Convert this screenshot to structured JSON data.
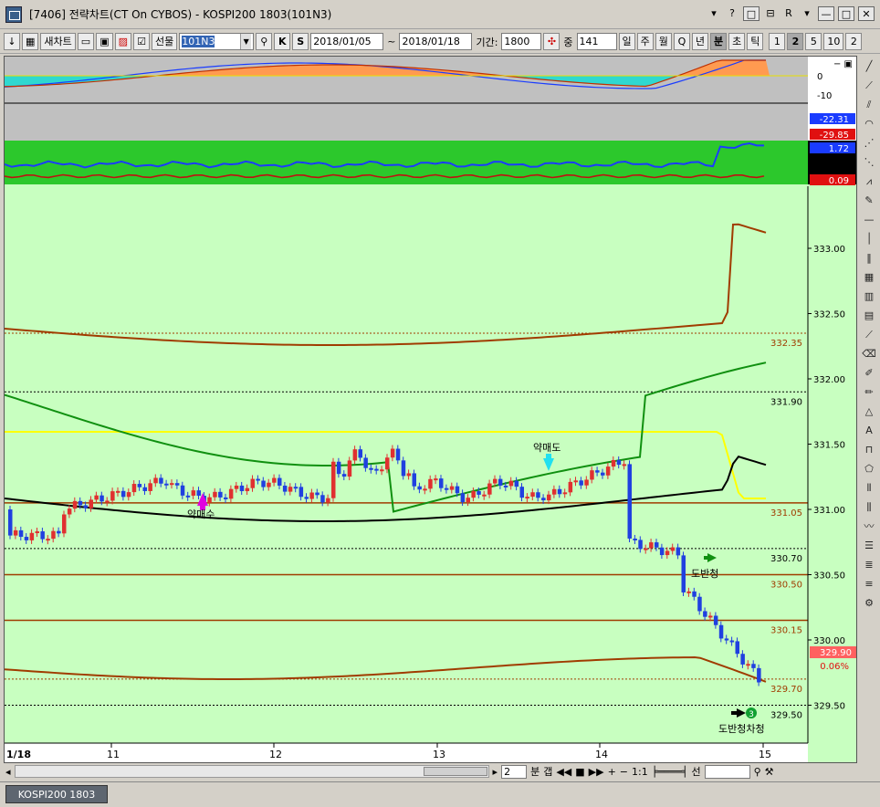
{
  "window": {
    "title": "[7406] 전략차트(CT On CYBOS) - KOSPI200 1803(101N3)",
    "controls": [
      "▾",
      "?",
      "□",
      "⊟",
      "R",
      "▾",
      "—",
      "□",
      "✕"
    ]
  },
  "toolbar": {
    "new_chart": "새차트",
    "market_label": "선물",
    "code": "101N3",
    "btn_k": "K",
    "btn_s": "S",
    "date_from": "2018/01/05",
    "tilde": "~",
    "date_to": "2018/01/18",
    "period_label": "기간:",
    "period_value": "1800",
    "count_label": "중",
    "count_value": "141",
    "periods": [
      "일",
      "주",
      "월",
      "Q",
      "년",
      "분",
      "초",
      "틱"
    ],
    "active_period": "분",
    "intervals": [
      "1",
      "2",
      "5",
      "10",
      "2"
    ],
    "active_interval": "2"
  },
  "indicators": {
    "top_axis": [
      "0",
      "-10"
    ],
    "top_badges": [
      {
        "value": "-22.31",
        "color": "#1a3cff"
      },
      {
        "value": "-29.85",
        "color": "#e01010"
      }
    ],
    "mid_badges": [
      {
        "value": "1.72",
        "color": "#1a3cff"
      },
      {
        "value": "0.09",
        "color": "#e01010"
      }
    ]
  },
  "price_axis": {
    "ticks": [
      "333.00",
      "332.50",
      "332.00",
      "331.50",
      "331.00",
      "330.50",
      "330.00",
      "329.50"
    ],
    "levels": [
      {
        "value": "332.35",
        "color": "#a03c00"
      },
      {
        "value": "331.90",
        "color": "#000000"
      },
      {
        "value": "331.05",
        "color": "#a03c00"
      },
      {
        "value": "330.70",
        "color": "#000000"
      },
      {
        "value": "330.50",
        "color": "#a03c00"
      },
      {
        "value": "330.15",
        "color": "#a03c00"
      },
      {
        "value": "329.70",
        "color": "#a03c00"
      },
      {
        "value": "329.50",
        "color": "#000000"
      }
    ],
    "current_price": "329.90",
    "current_pct": "0.06%"
  },
  "time_axis": [
    "1/18",
    "11",
    "12",
    "13",
    "14",
    "15"
  ],
  "annotations": {
    "weak_buy": "약매수",
    "weak_sell": "약매도",
    "sell_reversal": "도반청",
    "sell_clear": "도반청차청",
    "badge_number": "3"
  },
  "scroll": {
    "value": "2",
    "unit": "분",
    "gap": "갭",
    "ratio": "1:1",
    "line": "선"
  },
  "status": {
    "tab": "KOSPI200 1803"
  },
  "colors": {
    "chart_bg": "#c8ffc0",
    "up_candle": "#e03030",
    "down_candle": "#2040e0",
    "ma_green": "#109010",
    "ma_black": "#000000",
    "envelope": "#a03c00",
    "yellow": "#ffff00"
  }
}
